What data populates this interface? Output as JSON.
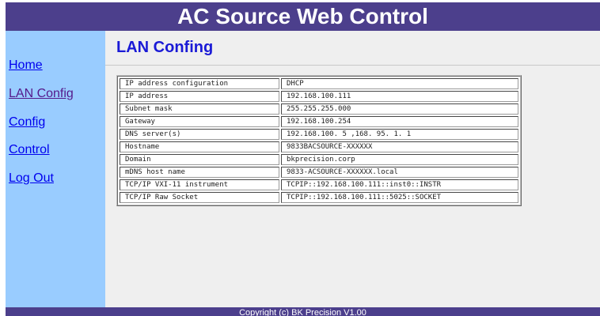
{
  "header": {
    "title": "AC Source Web Control"
  },
  "sidebar": {
    "items": [
      {
        "label": "Home"
      },
      {
        "label": "LAN Config"
      },
      {
        "label": "Config"
      },
      {
        "label": "Control"
      },
      {
        "label": "Log Out"
      }
    ]
  },
  "main": {
    "title": "LAN Confing",
    "rows": [
      {
        "label": "IP address configuration",
        "value": "DHCP"
      },
      {
        "label": "IP address",
        "value": "192.168.100.111"
      },
      {
        "label": "Subnet mask",
        "value": "255.255.255.000"
      },
      {
        "label": "Gateway",
        "value": "192.168.100.254"
      },
      {
        "label": "DNS server(s)",
        "value": "192.168.100. 5 ,168. 95. 1. 1"
      },
      {
        "label": "Hostname",
        "value": "9833BACSOURCE-XXXXXX"
      },
      {
        "label": "Domain",
        "value": "bkprecision.corp"
      },
      {
        "label": "mDNS host name",
        "value": "9833-ACSOURCE-XXXXXX.local"
      },
      {
        "label": "TCP/IP VXI-11 instrument",
        "value": "TCPIP::192.168.100.111::inst0::INSTR"
      },
      {
        "label": "TCP/IP Raw Socket",
        "value": "TCPIP::192.168.100.111::5025::SOCKET"
      }
    ]
  },
  "footer": {
    "copyright": "Copyright (c) BK Precision V1.00"
  },
  "colors": {
    "header_bg": "#4c3f8c",
    "sidebar_bg": "#99ccff",
    "main_bg": "#efefef",
    "title_color": "#1a1ad6",
    "link_color": "#0000ee",
    "visited_link_color": "#551a8b"
  }
}
